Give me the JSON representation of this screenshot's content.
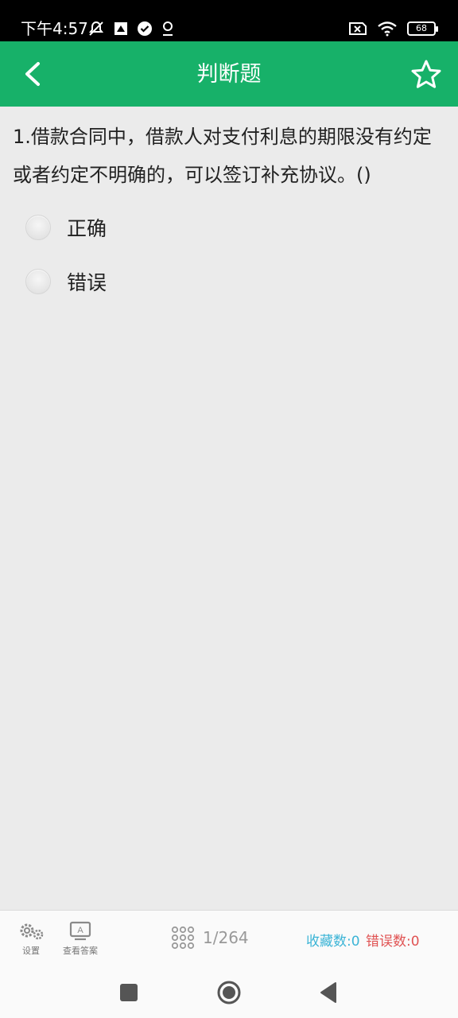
{
  "status": {
    "time": "下午4:57",
    "battery": "68"
  },
  "appbar": {
    "title": "判断题",
    "back_icon": "chevron-left-icon",
    "star_icon": "star-outline-icon"
  },
  "question": {
    "text": "1.借款合同中，借款人对支付利息的期限没有约定或者约定不明确的，可以签订补充协议。()"
  },
  "options": [
    {
      "label": "正确"
    },
    {
      "label": "错误"
    }
  ],
  "toolbar": {
    "settings_label": "设置",
    "answer_label": "查看答案",
    "answer_icon_glyph": "A",
    "progress": "1/264",
    "favorites": "收藏数:0",
    "errors": "错误数:0"
  },
  "colors": {
    "accent": "#17b169",
    "favorite": "#3bb4d6",
    "error": "#e05252"
  }
}
